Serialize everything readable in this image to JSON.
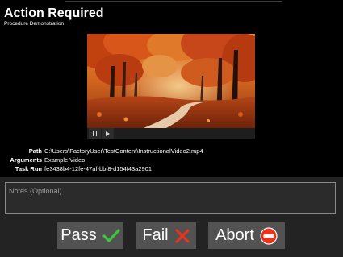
{
  "header": {
    "title": "Action Required",
    "subtitle": "Procedure Demonstration"
  },
  "media": {
    "controls": [
      "pause-icon",
      "play-icon"
    ]
  },
  "details": {
    "path_label": "Path",
    "path_value": "C:\\Users\\FactoryUser\\TestContent\\InstructionalVideo2.mp4",
    "arguments_label": "Arguments",
    "arguments_value": "Example Video",
    "task_run_label": "Task Run",
    "task_run_value": "fe3438b4-12fe-47af-bbf8-d154f43a2901"
  },
  "notes": {
    "placeholder": "Notes (Optional)",
    "value": ""
  },
  "actions": {
    "pass_label": "Pass",
    "pass_icon": "checkmark-icon",
    "fail_label": "Fail",
    "fail_icon": "x-icon",
    "abort_label": "Abort",
    "abort_icon": "no-entry-icon"
  },
  "colors": {
    "background": "#000000",
    "panel": "#232323",
    "button": "#525252",
    "pass_accent": "#3cc83c",
    "fail_accent": "#e8341c",
    "abort_accent": "#e8341c"
  }
}
